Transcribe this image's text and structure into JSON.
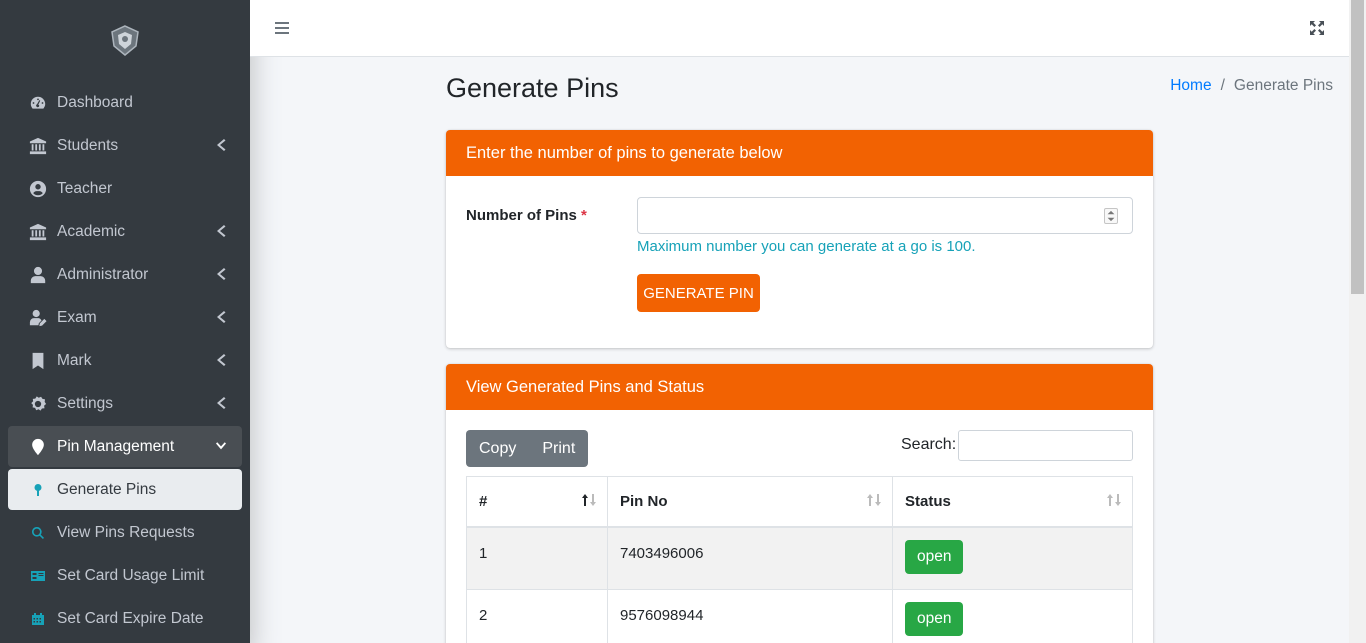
{
  "sidebar": {
    "items": [
      {
        "label": "Dashboard",
        "icon": "dashboard-icon"
      },
      {
        "label": "Students",
        "icon": "institution-icon"
      },
      {
        "label": "Teacher",
        "icon": "user-circle-icon"
      },
      {
        "label": "Academic",
        "icon": "institution-icon"
      },
      {
        "label": "Administrator",
        "icon": "user-icon"
      },
      {
        "label": "Exam",
        "icon": "user-edit-icon"
      },
      {
        "label": "Mark",
        "icon": "bookmark-icon"
      },
      {
        "label": "Settings",
        "icon": "gear-icon"
      },
      {
        "label": "Pin Management",
        "icon": "map-marker-icon"
      },
      {
        "label": "Generate Pins",
        "icon": "pin-icon"
      },
      {
        "label": "View Pins Requests",
        "icon": "search-icon"
      },
      {
        "label": "Set Card Usage Limit",
        "icon": "id-card-icon"
      },
      {
        "label": "Set Card Expire Date",
        "icon": "calendar-icon"
      }
    ]
  },
  "page": {
    "title": "Generate Pins",
    "breadcrumb": {
      "home": "Home",
      "sep": "/",
      "current": "Generate Pins"
    }
  },
  "form_card": {
    "header": "Enter the number of pins to generate below",
    "label": "Number of Pins",
    "required_mark": "*",
    "input_value": "",
    "hint": "Maximum number you can generate at a go is 100.",
    "button": "GENERATE PIN"
  },
  "table_card": {
    "header": "View Generated Pins and Status",
    "buttons": {
      "copy": "Copy",
      "print": "Print"
    },
    "search_label": "Search:",
    "columns": [
      "#",
      "Pin No",
      "Status"
    ],
    "rows": [
      {
        "num": "1",
        "pin": "7403496006",
        "status": "open"
      },
      {
        "num": "2",
        "pin": "9576098944",
        "status": "open"
      }
    ]
  },
  "colors": {
    "accent": "#f26202",
    "sidebar": "#343a40",
    "hint": "#17a2b8",
    "status": "#28a745"
  }
}
